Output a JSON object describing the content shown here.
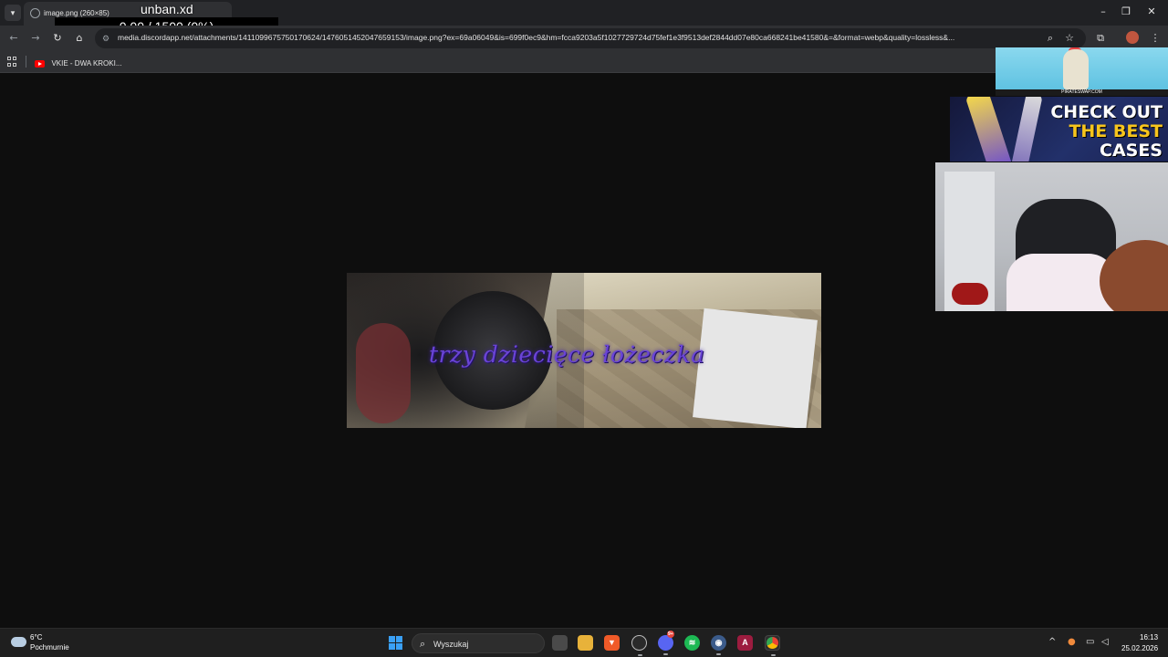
{
  "overlay": {
    "title": "unban.xd",
    "counter": "0.00 / 1500 (0%)"
  },
  "tab": {
    "title": "image.png (260×85)"
  },
  "address_bar": {
    "url": "media.discordapp.net/attachments/1411099675750170624/1476051452047659153/image.png?ex=69a06049&is=699f0ec9&hm=fcca9203a5f1027729724d75fef1e3f9513def2844dd07e80ca668241be41580&=&format=webp&quality=lossless&..."
  },
  "bookmarks": [
    {
      "label": "VKIE - DWA KROKI...",
      "icon": "youtube-icon"
    }
  ],
  "image": {
    "caption": "trzy dziecięce łożeczka"
  },
  "ads": {
    "top_footer": "PIRATESWAP.COM",
    "banner_line1": "CHECK OUT",
    "banner_line2": "THE BEST",
    "banner_line3": "CASES"
  },
  "taskbar": {
    "weather_temp": "6°C",
    "weather_desc": "Pochmurnie",
    "search_placeholder": "Wyszukaj",
    "discord_badge": "9+",
    "time": "16:13",
    "date": "25.02.2026"
  },
  "colors": {
    "browser_bg": "#202124",
    "toolbar_bg": "#2f3033",
    "page_bg": "#0e0e0e",
    "caption_purple": "#6a44d6",
    "banner_yellow": "#f7c51c",
    "start_blue": "#3aa0f5"
  }
}
